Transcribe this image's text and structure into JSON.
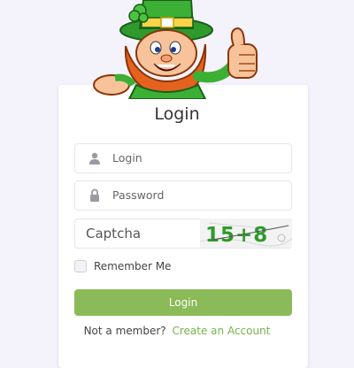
{
  "form": {
    "title": "Login",
    "login_placeholder": "Login",
    "password_placeholder": "Password",
    "captcha_placeholder": "Captcha",
    "captcha_image_text": "15+8",
    "remember_label": "Remember Me",
    "remember_checked": false,
    "submit_label": "Login",
    "signup_prompt": "Not a member?",
    "signup_link": "Create an Account"
  },
  "colors": {
    "accent": "#8bbb58",
    "link": "#79b14b",
    "background": "#f4f3fb"
  },
  "icons": {
    "login": "user-icon",
    "password": "lock-icon",
    "mascot": "leprechaun-mascot"
  }
}
